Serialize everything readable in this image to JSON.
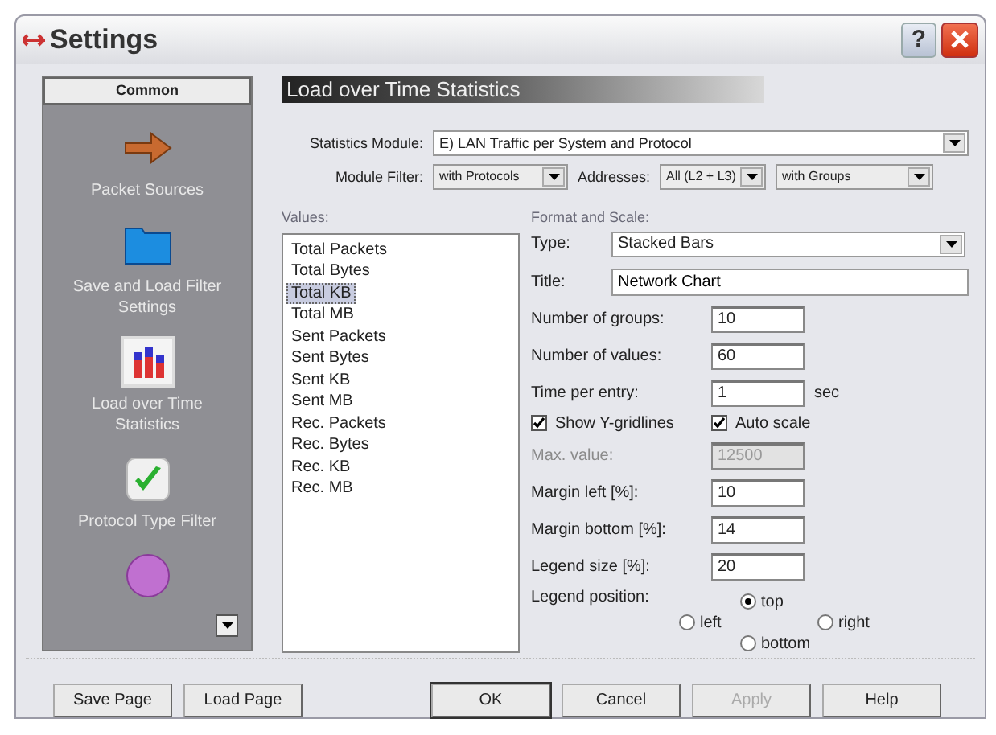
{
  "window": {
    "title": "Settings",
    "help": "?"
  },
  "sidebar": {
    "header": "Common",
    "items": [
      {
        "kind": "arrow",
        "label": "Packet Sources",
        "selected": false
      },
      {
        "kind": "folder",
        "label": "Save and Load Filter Settings",
        "selected": false
      },
      {
        "kind": "chart",
        "label": "Load over Time Statistics",
        "selected": true
      },
      {
        "kind": "check",
        "label": "Protocol Type Filter",
        "selected": false
      },
      {
        "kind": "globe",
        "selected": false
      }
    ]
  },
  "panel": {
    "title": "Load over Time Statistics",
    "statistics_module": {
      "label": "Statistics Module:",
      "value": "E) LAN Traffic per System and Protocol"
    },
    "module_filter": {
      "label": "Module Filter:",
      "value": "with Protocols"
    },
    "addresses": {
      "label": "Addresses:",
      "value": "All (L2 + L3)",
      "grouping": "with Groups"
    },
    "values": {
      "label": "Values:",
      "items": [
        {
          "label": "Total Packets",
          "selected": false
        },
        {
          "label": "Total Bytes",
          "selected": false
        },
        {
          "label": "Total KB",
          "selected": true
        },
        {
          "label": "Total MB",
          "selected": false
        },
        {
          "label": "Sent Packets",
          "selected": false
        },
        {
          "label": "Sent Bytes",
          "selected": false
        },
        {
          "label": "Sent KB",
          "selected": false
        },
        {
          "label": "Sent MB",
          "selected": false
        },
        {
          "label": "Rec. Packets",
          "selected": false
        },
        {
          "label": "Rec. Bytes",
          "selected": false
        },
        {
          "label": "Rec. KB",
          "selected": false
        },
        {
          "label": "Rec. MB",
          "selected": false
        }
      ]
    },
    "format": {
      "label": "Format and Scale:",
      "type": {
        "label": "Type:",
        "value": "Stacked Bars"
      },
      "title": {
        "label": "Title:",
        "value": "Network Chart"
      },
      "rows": [
        {
          "kind": "input",
          "label": "Number of groups:",
          "value": "10",
          "disabled": false
        },
        {
          "kind": "input",
          "label": "Number of values:",
          "value": "60",
          "disabled": false
        },
        {
          "kind": "input",
          "label": "Time per entry:",
          "value": "1",
          "unit": "sec",
          "disabled": false
        },
        {
          "kind": "checks",
          "items": [
            {
              "label": "Show Y-gridlines",
              "checked": true
            },
            {
              "label": "Auto scale",
              "checked": true
            }
          ]
        },
        {
          "kind": "input",
          "label": "Max. value:",
          "value": "12500",
          "disabled": true
        },
        {
          "kind": "input",
          "label": "Margin left [%]:",
          "value": "10",
          "disabled": false
        },
        {
          "kind": "input",
          "label": "Margin bottom [%]:",
          "value": "14",
          "disabled": false
        },
        {
          "kind": "input",
          "label": "Legend size [%]:",
          "value": "20",
          "disabled": false
        }
      ],
      "legend_position": {
        "label": "Legend position:",
        "options": [
          {
            "kind": "top",
            "label": "top",
            "selected": true
          },
          {
            "kind": "left",
            "label": "left",
            "selected": false
          },
          {
            "kind": "right",
            "label": "right",
            "selected": false
          },
          {
            "kind": "bottom",
            "label": "bottom",
            "selected": false
          }
        ]
      }
    }
  },
  "page_buttons": [
    {
      "label": "Save Page",
      "default": false,
      "disabled": false
    },
    {
      "label": "Load Page",
      "default": false,
      "disabled": false
    }
  ],
  "dialog_buttons": [
    {
      "label": "OK",
      "default": true,
      "disabled": false
    },
    {
      "label": "Cancel",
      "default": false,
      "disabled": false
    },
    {
      "label": "Apply",
      "default": false,
      "disabled": true
    },
    {
      "label": "Help",
      "default": false,
      "disabled": false
    }
  ]
}
